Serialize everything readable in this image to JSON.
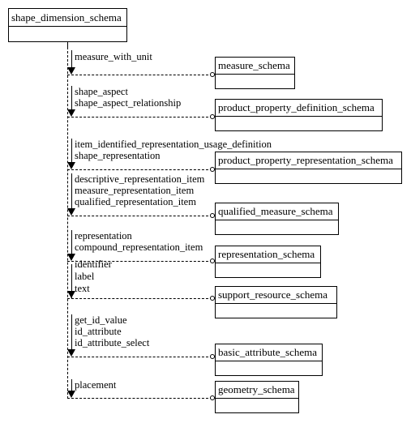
{
  "diagram": {
    "type": "express-g-schema-interface",
    "title": "shape_dimension_schema",
    "root_schema": {
      "name": "shape_dimension_schema"
    },
    "referenced_schemas": [
      {
        "name": "measure_schema",
        "constructs": [
          "measure_with_unit"
        ]
      },
      {
        "name": "product_property_definition_schema",
        "constructs": [
          "shape_aspect",
          "shape_aspect_relationship"
        ]
      },
      {
        "name": "product_property_representation_schema",
        "constructs": [
          "item_identified_representation_usage_definition",
          "shape_representation"
        ]
      },
      {
        "name": "qualified_measure_schema",
        "constructs": [
          "descriptive_representation_item",
          "measure_representation_item",
          "qualified_representation_item"
        ]
      },
      {
        "name": "representation_schema",
        "constructs": [
          "representation",
          "compound_representation_item"
        ]
      },
      {
        "name": "support_resource_schema",
        "constructs": [
          "identifier",
          "label",
          "text"
        ]
      },
      {
        "name": "basic_attribute_schema",
        "constructs": [
          "get_id_value",
          "id_attribute",
          "id_attribute_select"
        ]
      },
      {
        "name": "geometry_schema",
        "constructs": [
          "placement"
        ]
      }
    ],
    "colors": {
      "line": "#000000",
      "background": "#ffffff",
      "text": "#000000"
    }
  }
}
